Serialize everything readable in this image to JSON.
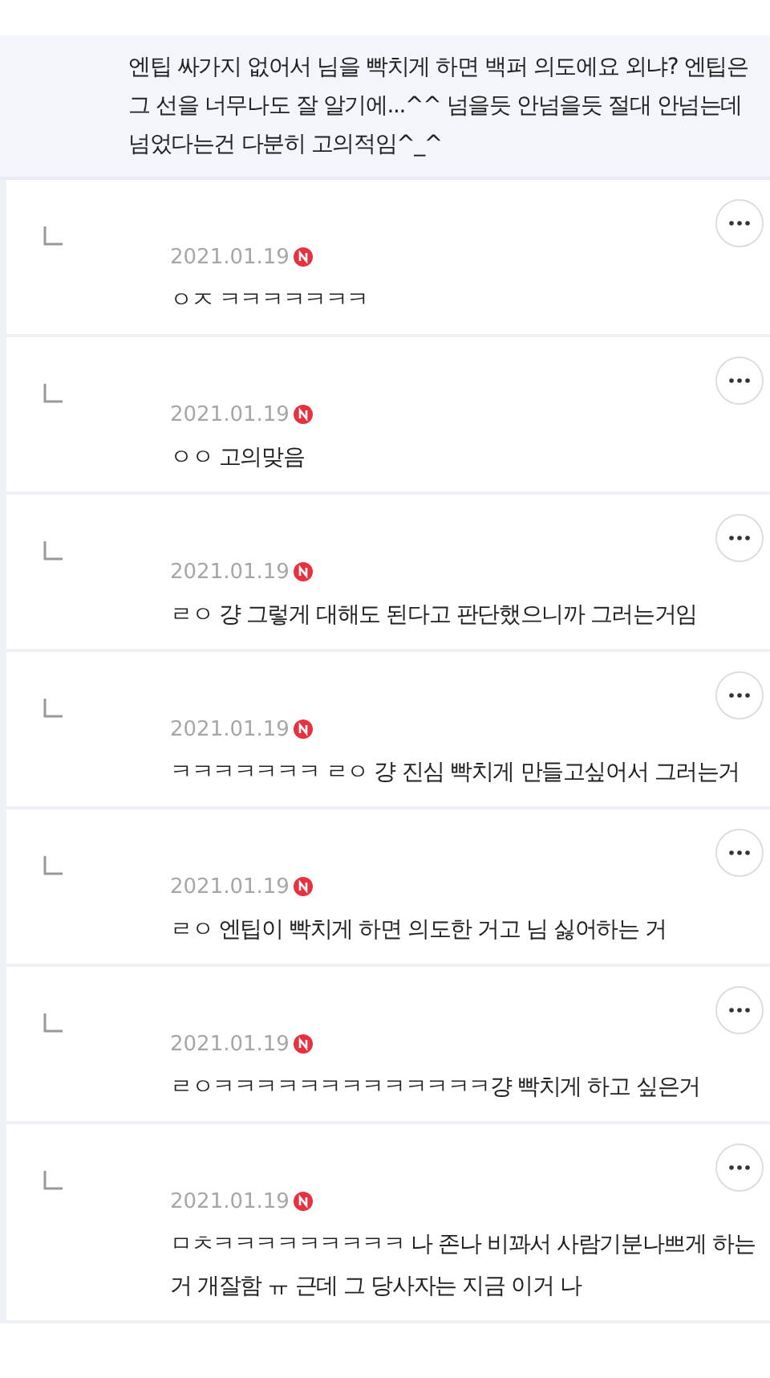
{
  "parent_comment": {
    "text": "엔팁 싸가지 없어서 님을 빡치게 하면 백퍼 의도에요 외냐? 엔팁은 그 선을 너무나도 잘 알기에...^^ 넘을듯 안넘을듯 절대 안넘는데 넘었다는건 다분히 고의적임^_^"
  },
  "replies": [
    {
      "date": "2021.01.19",
      "new": true,
      "text": "ㅇㅈ ㅋㅋㅋㅋㅋㅋㅋ"
    },
    {
      "date": "2021.01.19",
      "new": true,
      "text": "ㅇㅇ 고의맞음"
    },
    {
      "date": "2021.01.19",
      "new": true,
      "text": "ㄹㅇ 걍 그렇게 대해도 된다고 판단했으니까 그러는거임"
    },
    {
      "date": "2021.01.19",
      "new": true,
      "text": "ㅋㅋㅋㅋㅋㅋㅋ ㄹㅇ 걍 진심 빡치게 만들고싶어서 그러는거"
    },
    {
      "date": "2021.01.19",
      "new": true,
      "text": "ㄹㅇ 엔팁이 빡치게 하면 의도한 거고 님 싫어하는 거"
    },
    {
      "date": "2021.01.19",
      "new": true,
      "text": "ㄹㅇㅋㅋㅋㅋㅋㅋㅋㅋㅋㅋㅋㅋㅋ걍 빡치게 하고 싶은거"
    },
    {
      "date": "2021.01.19",
      "new": true,
      "text": "ㅁㅊㅋㅋㅋㅋㅋㅋㅋㅋㅋ 나 존나 비꽈서 사람기분나쁘게 하는거 개잘함 ㅠ 근데 그 당사자는 지금 이거 나"
    }
  ]
}
